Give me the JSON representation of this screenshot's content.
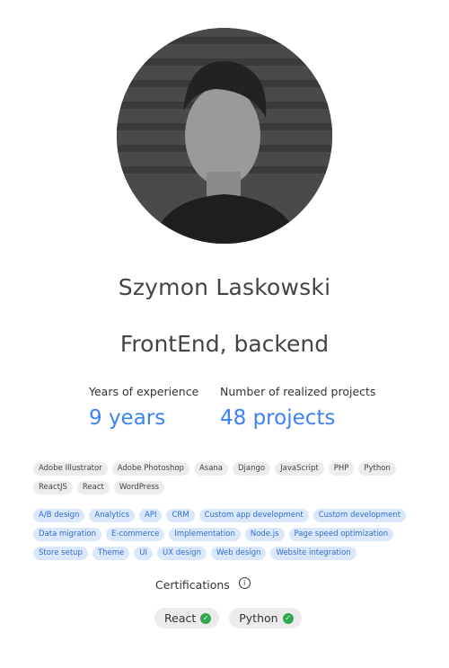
{
  "profile": {
    "name": "Szymon Laskowski",
    "role": "FrontEnd, backend"
  },
  "stats": {
    "years_label": "Years of experience",
    "years_value": "9 years",
    "projects_label": "Number of realized projects",
    "projects_value": "48 projects",
    "accent_color": "#3b82f6"
  },
  "skills": [
    "Adobe Illustrator",
    "Adobe Photoshop",
    "Asana",
    "Django",
    "JavaScript",
    "PHP",
    "Python",
    "ReactJS",
    "React",
    "WordPress"
  ],
  "services": [
    "A/B design",
    "Analytics",
    "API",
    "CRM",
    "Custom app development",
    "Custom development",
    "Data migration",
    "E-commerce",
    "Implementation",
    "Node.js",
    "Page speed optimization",
    "Store setup",
    "Theme",
    "UI",
    "UX design",
    "Web design",
    "Website integration"
  ],
  "certifications": {
    "title": "Certifications",
    "info_icon": "info-icon",
    "items": [
      {
        "label": "React",
        "icon": "check-circle-icon",
        "color": "#2fa84f"
      },
      {
        "label": "Python",
        "icon": "check-circle-icon",
        "color": "#2fa84f"
      }
    ]
  }
}
